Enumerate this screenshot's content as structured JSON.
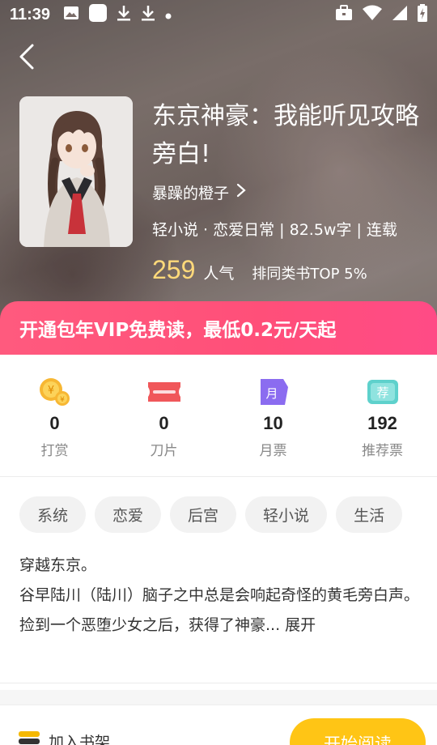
{
  "status_bar": {
    "time": "11:39"
  },
  "book": {
    "title": "东京神豪：我能听见攻略旁白!",
    "author": "暴躁的橙子",
    "meta": "轻小说 · 恋爱日常 | 82.5w字 | 连载",
    "popularity_value": "259",
    "popularity_label": "人气",
    "rank": "排同类书TOP 5%"
  },
  "vip_banner": "开通包年VIP免费读，最低0.2元/天起",
  "stats": [
    {
      "value": "0",
      "label": "打赏",
      "icon": "coins-icon"
    },
    {
      "value": "0",
      "label": "刀片",
      "icon": "blade-icon"
    },
    {
      "value": "10",
      "label": "月票",
      "icon": "monthly-ticket-icon"
    },
    {
      "value": "192",
      "label": "推荐票",
      "icon": "recommend-ticket-icon"
    }
  ],
  "tags": [
    "系统",
    "恋爱",
    "后宫",
    "轻小说",
    "生活"
  ],
  "description": {
    "line1": "穿越东京。",
    "line2": "谷早陆川（陆川）脑子之中总是会响起奇怪的黄毛旁白声。",
    "line3": "捡到一个恶堕少女之后，获得了神豪...",
    "expand": "展开"
  },
  "bottom_bar": {
    "shelf_label": "加入书架",
    "read_label": "开始阅读"
  },
  "colors": {
    "vip_banner": "#ff5079",
    "popularity": "#ffd97a",
    "read_button": "#ffc515"
  }
}
